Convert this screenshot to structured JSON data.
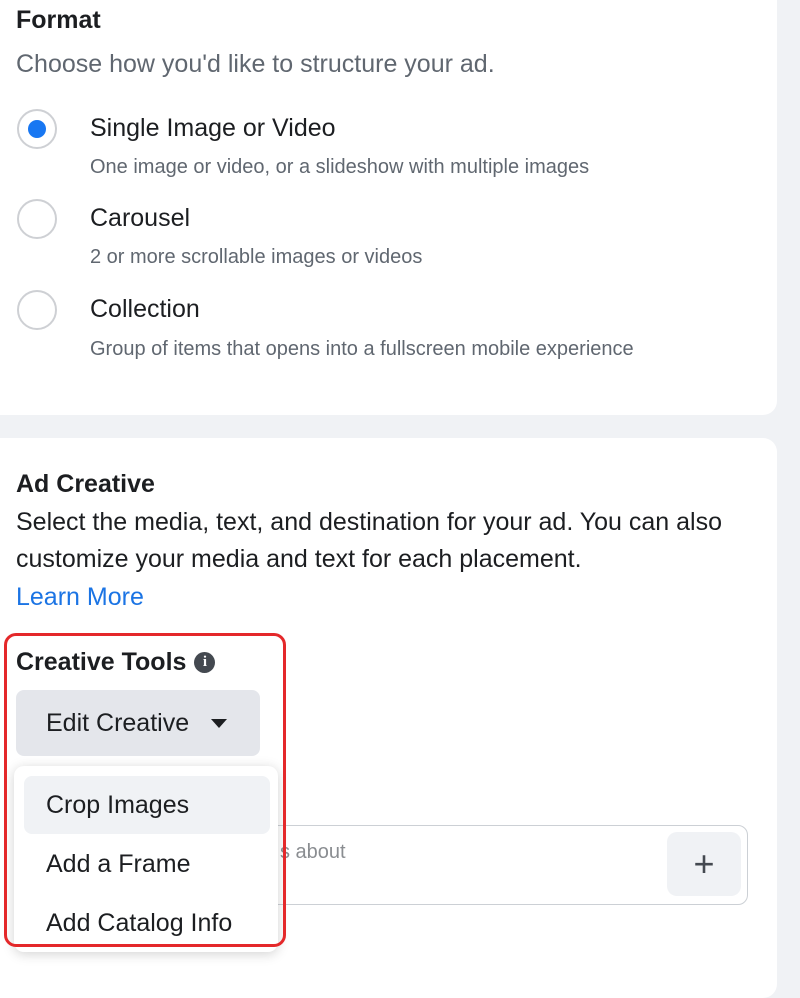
{
  "format": {
    "title": "Format",
    "subtitle": "Choose how you'd like to structure your ad.",
    "options": [
      {
        "label": "Single Image or Video",
        "description": "One image or video, or a slideshow with multiple images",
        "selected": true
      },
      {
        "label": "Carousel",
        "description": "2 or more scrollable images or videos",
        "selected": false
      },
      {
        "label": "Collection",
        "description": "Group of items that opens into a fullscreen mobile experience",
        "selected": false
      }
    ]
  },
  "ad_creative": {
    "title": "Ad Creative",
    "description": "Select the media, text, and destination for your ad. You can also customize your media and text for each placement.",
    "learn_more": "Learn More"
  },
  "creative_tools": {
    "title": "Creative Tools",
    "info_glyph": "i",
    "edit_button": "Edit Creative",
    "menu": [
      "Crop Images",
      "Add a Frame",
      "Add Catalog Info"
    ]
  },
  "background_field": {
    "partial_text": "s about",
    "add_glyph": "+"
  },
  "colors": {
    "accent": "#1877f2",
    "link": "#1b74e4",
    "highlight": "#e4282a"
  }
}
